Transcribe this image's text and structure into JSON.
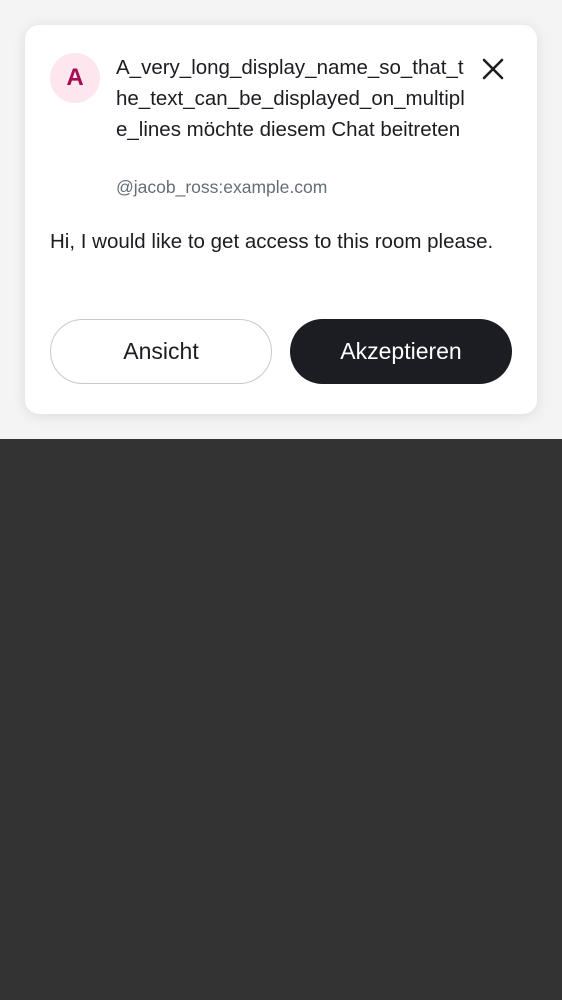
{
  "notification": {
    "avatar_letter": "A",
    "display_name": "A_very_long_display_name_so_that_the_text_can_be_displayed_on_multiple_lines",
    "action_text": " möchte diesem Chat beitreten",
    "user_id": "@jacob_ross:example.com",
    "message": "Hi, I would like to get access to this room please.",
    "close_icon": "close-icon",
    "view_label": "Ansicht",
    "accept_label": "Akzeptieren"
  },
  "colors": {
    "avatar_background": "#fde6ee",
    "avatar_letter": "#a50d53",
    "accept_button": "#1b1d22",
    "top_background": "#f4f4f5",
    "bottom_background": "#333333"
  }
}
